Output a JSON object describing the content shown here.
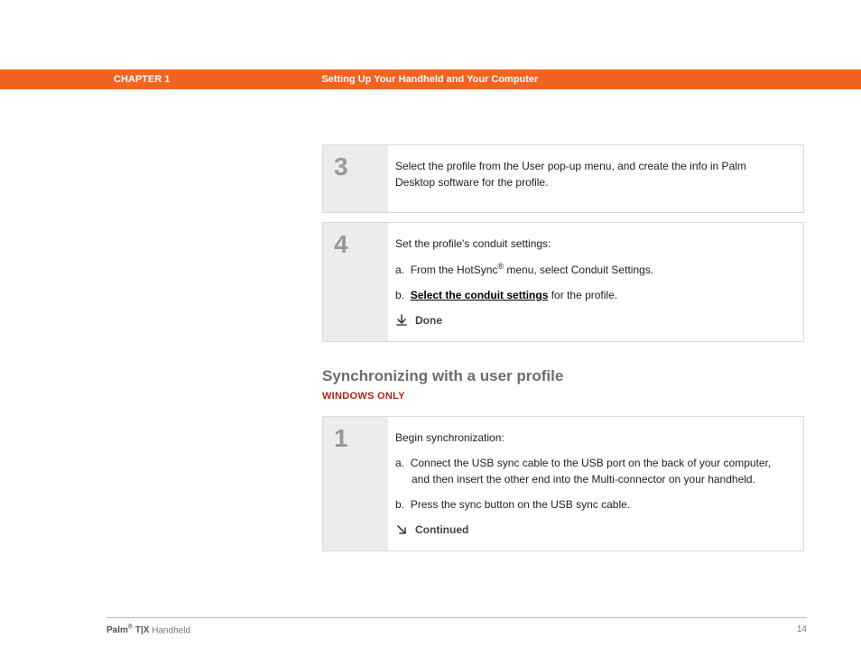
{
  "header": {
    "chapter": "CHAPTER 1",
    "section": "Setting Up Your Handheld and Your Computer"
  },
  "steps_top": [
    {
      "num": "3",
      "intro": "Select the profile from the User pop-up menu, and create the info in Palm Desktop software for the profile.",
      "items": [],
      "closer": null
    },
    {
      "num": "4",
      "intro": "Set the profile's conduit settings:",
      "items": [
        {
          "letter": "a.",
          "before": "From the HotSync",
          "reg": "®",
          "after": " menu, select Conduit Settings."
        },
        {
          "letter": "b.",
          "link": "Select the conduit settings",
          "after_link": " for the profile."
        }
      ],
      "closer": "Done"
    }
  ],
  "subsection": {
    "heading": "Synchronizing with a user profile",
    "platform": "WINDOWS ONLY"
  },
  "steps_bottom": [
    {
      "num": "1",
      "intro": "Begin synchronization:",
      "items": [
        {
          "letter": "a.",
          "text": "Connect the USB sync cable to the USB port on the back of your computer, and then insert the other end into the Multi-connector on your handheld."
        },
        {
          "letter": "b.",
          "text": "Press the sync button on the USB sync cable."
        }
      ],
      "closer": "Continued"
    }
  ],
  "footer": {
    "brand_bold": "Palm",
    "brand_reg": "®",
    "brand_model": " T|X",
    "brand_tail": " Handheld",
    "page": "14"
  }
}
